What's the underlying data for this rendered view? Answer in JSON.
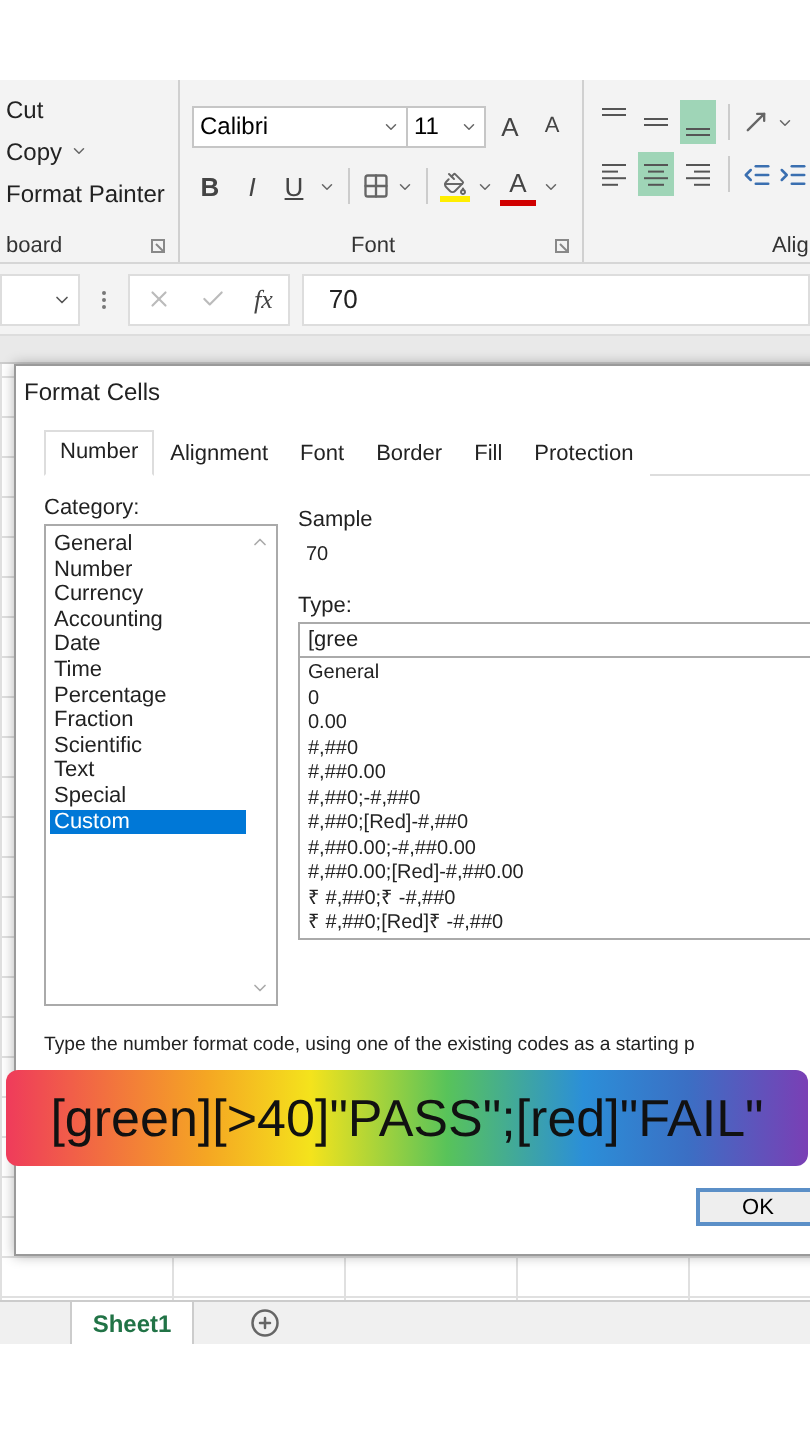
{
  "ribbon": {
    "clipboard": {
      "items": [
        {
          "label": "Cut",
          "has_dropdown": false
        },
        {
          "label": "Copy",
          "has_dropdown": true
        },
        {
          "label": "Format Painter",
          "has_dropdown": false
        }
      ],
      "group_label": "board"
    },
    "font": {
      "font_name": "Calibri",
      "font_size": "11",
      "grow_label": "A",
      "shrink_label": "A",
      "bold": "B",
      "italic": "I",
      "underline": "U",
      "font_color_label": "A",
      "group_label": "Font"
    },
    "alignment": {
      "vertical": [
        {
          "kind": "top",
          "selected": false
        },
        {
          "kind": "middle",
          "selected": false
        },
        {
          "kind": "bottom",
          "selected": true
        }
      ],
      "horizontal": [
        {
          "kind": "left",
          "selected": false
        },
        {
          "kind": "center",
          "selected": true
        },
        {
          "kind": "right",
          "selected": false
        }
      ],
      "group_label": "Alig"
    }
  },
  "formula_bar": {
    "fx": "fx",
    "value": "70"
  },
  "dialog": {
    "title": "Format Cells",
    "tabs": [
      {
        "label": "Number",
        "selected": true
      },
      {
        "label": "Alignment",
        "selected": false
      },
      {
        "label": "Font",
        "selected": false
      },
      {
        "label": "Border",
        "selected": false
      },
      {
        "label": "Fill",
        "selected": false
      },
      {
        "label": "Protection",
        "selected": false
      }
    ],
    "category_label": "Category:",
    "categories": [
      {
        "label": "General",
        "selected": false
      },
      {
        "label": "Number",
        "selected": false
      },
      {
        "label": "Currency",
        "selected": false
      },
      {
        "label": "Accounting",
        "selected": false
      },
      {
        "label": "Date",
        "selected": false
      },
      {
        "label": "Time",
        "selected": false
      },
      {
        "label": "Percentage",
        "selected": false
      },
      {
        "label": "Fraction",
        "selected": false
      },
      {
        "label": "Scientific",
        "selected": false
      },
      {
        "label": "Text",
        "selected": false
      },
      {
        "label": "Special",
        "selected": false
      },
      {
        "label": "Custom",
        "selected": true
      }
    ],
    "sample_label": "Sample",
    "sample_value": "70",
    "type_label": "Type:",
    "type_value": "[gree",
    "type_list": [
      "General",
      "0",
      "0.00",
      "#,##0",
      "#,##0.00",
      "#,##0;-#,##0",
      "#,##0;[Red]-#,##0",
      "#,##0.00;-#,##0.00",
      "#,##0.00;[Red]-#,##0.00",
      "₹ #,##0;₹ -#,##0",
      "₹ #,##0;[Red]₹ -#,##0"
    ],
    "hint": "Type the number format code, using one of the existing codes as a starting p",
    "ok_button": "OK"
  },
  "caption": "[green][>40]\"PASS\";[red]\"FAIL\"",
  "sheet_tabs": [
    {
      "label": "Sheet1",
      "selected": true
    }
  ]
}
